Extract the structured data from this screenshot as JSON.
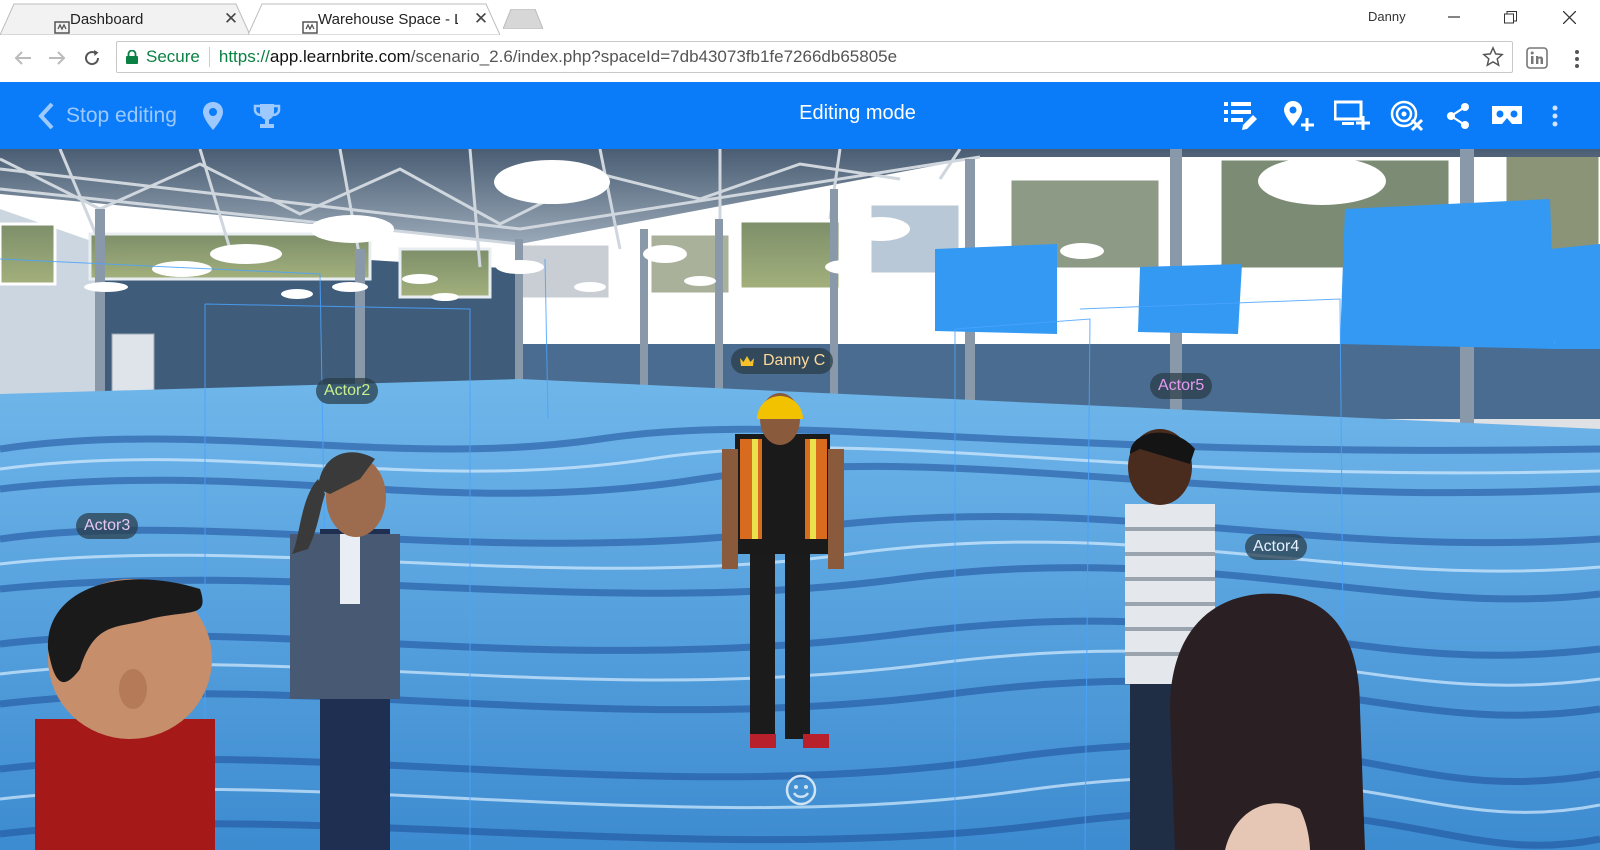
{
  "browser": {
    "tabs": [
      {
        "title": "Dashboard",
        "active": false
      },
      {
        "title": "Warehouse Space - Learn",
        "active": true
      }
    ],
    "profile_name": "Danny",
    "address": {
      "secure_label": "Secure",
      "scheme": "https://",
      "host": "app.learnbrite.com",
      "path": "/scenario_2.6/index.php?spaceId=7db43073fb1fe7266db65805e"
    }
  },
  "appbar": {
    "stop_editing_label": "Stop editing",
    "mode_title": "Editing mode",
    "bg_color": "#0a7cfa"
  },
  "scene": {
    "labels": {
      "actor2": "Actor2",
      "actor3": "Actor3",
      "actor4": "Actor4",
      "actor5": "Actor5",
      "player": "Danny C"
    },
    "label_colors": {
      "actor2": "#c9f08a",
      "actor3": "#e7c7f0",
      "actor4": "#e6f1ff",
      "actor5": "#e79af0",
      "player": "#ffd99a"
    }
  },
  "icons": {
    "favicon": "learnbrite-icon",
    "extension": "linkedin-icon",
    "crown": "crown-icon",
    "emoji": "smiley-icon"
  }
}
